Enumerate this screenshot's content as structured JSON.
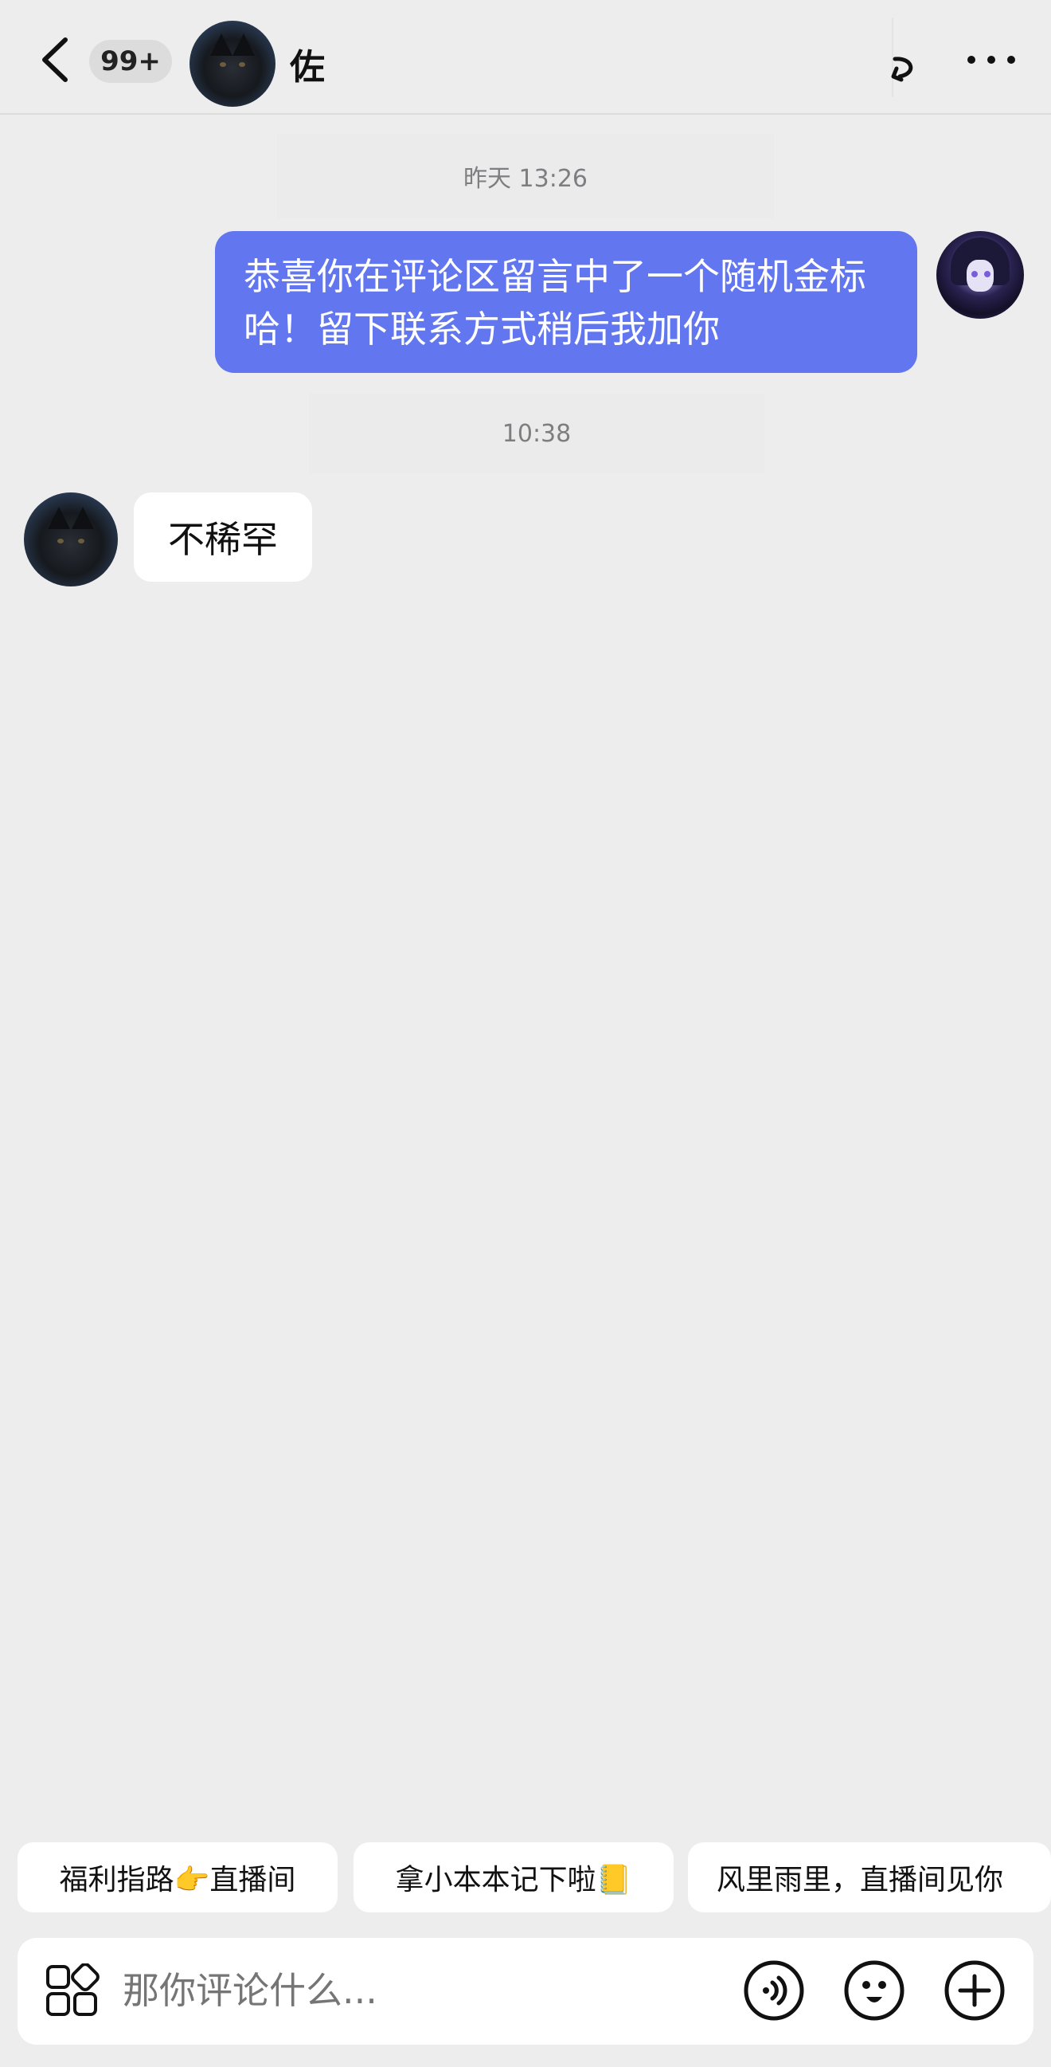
{
  "header": {
    "unread_badge": "99+",
    "contact_name": "佐"
  },
  "messages": [
    {
      "type": "timestamp",
      "text": "昨天 13:26"
    },
    {
      "type": "outgoing",
      "text": "恭喜你在评论区留言中了一个随机金标哈！留下联系方式稍后我加你"
    },
    {
      "type": "timestamp",
      "text": "10:38"
    },
    {
      "type": "incoming",
      "text": "不稀罕"
    }
  ],
  "quick_replies": [
    "福利指路👉直播间",
    "拿小本本记下啦📒",
    "风里雨里，直播间见你"
  ],
  "input": {
    "placeholder": "那你评论什么..."
  },
  "colors": {
    "outgoing_bubble": "#6277ef",
    "background": "#ededee",
    "incoming_bubble": "#ffffff"
  },
  "icons": [
    "back-icon",
    "share-icon",
    "more-icon",
    "apps-grid-icon",
    "voice-icon",
    "emoji-icon",
    "plus-icon"
  ]
}
